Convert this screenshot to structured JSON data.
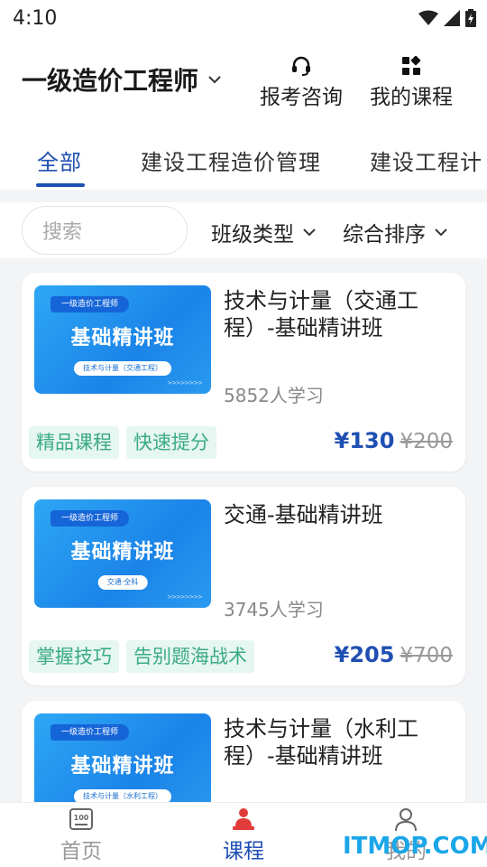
{
  "status_bar": {
    "time": "4:10"
  },
  "header": {
    "exam_title": "一级造价工程师",
    "consult_label": "报考咨询",
    "my_courses_label": "我的课程"
  },
  "tabs": [
    "全部",
    "建设工程造价管理",
    "建设工程计"
  ],
  "filters": {
    "search_placeholder": "搜索",
    "class_type_label": "班级类型",
    "sort_label": "综合排序"
  },
  "courses": [
    {
      "title": "技术与计量（交通工程）-基础精讲班",
      "thumb_tag": "一级造价工程师",
      "thumb_main": "基础精讲班",
      "thumb_sub": "技术与计量（交通工程）",
      "learners": "5852人学习",
      "tags": [
        "精品课程",
        "快速提分"
      ],
      "price": "¥130",
      "original_price": "¥200"
    },
    {
      "title": "交通-基础精讲班",
      "thumb_tag": "一级造价工程师",
      "thumb_main": "基础精讲班",
      "thumb_sub": "交通·全科",
      "learners": "3745人学习",
      "tags": [
        "掌握技巧",
        "告别题海战术"
      ],
      "price": "¥205",
      "original_price": "¥700"
    },
    {
      "title": "技术与计量（水利工程）-基础精讲班",
      "thumb_tag": "一级造价工程师",
      "thumb_main": "基础精讲班",
      "thumb_sub": "技术与计量（水利工程）"
    }
  ],
  "bottom_nav": {
    "home_label": "首页",
    "course_label": "课程",
    "mine_label": "我的"
  },
  "watermark": "ITMOP.COM",
  "colors": {
    "accent": "#1f4fb3",
    "chip_bg": "#e6f6f1",
    "chip_text": "#3aaa86",
    "thumb_blue": "#1b84e8"
  }
}
